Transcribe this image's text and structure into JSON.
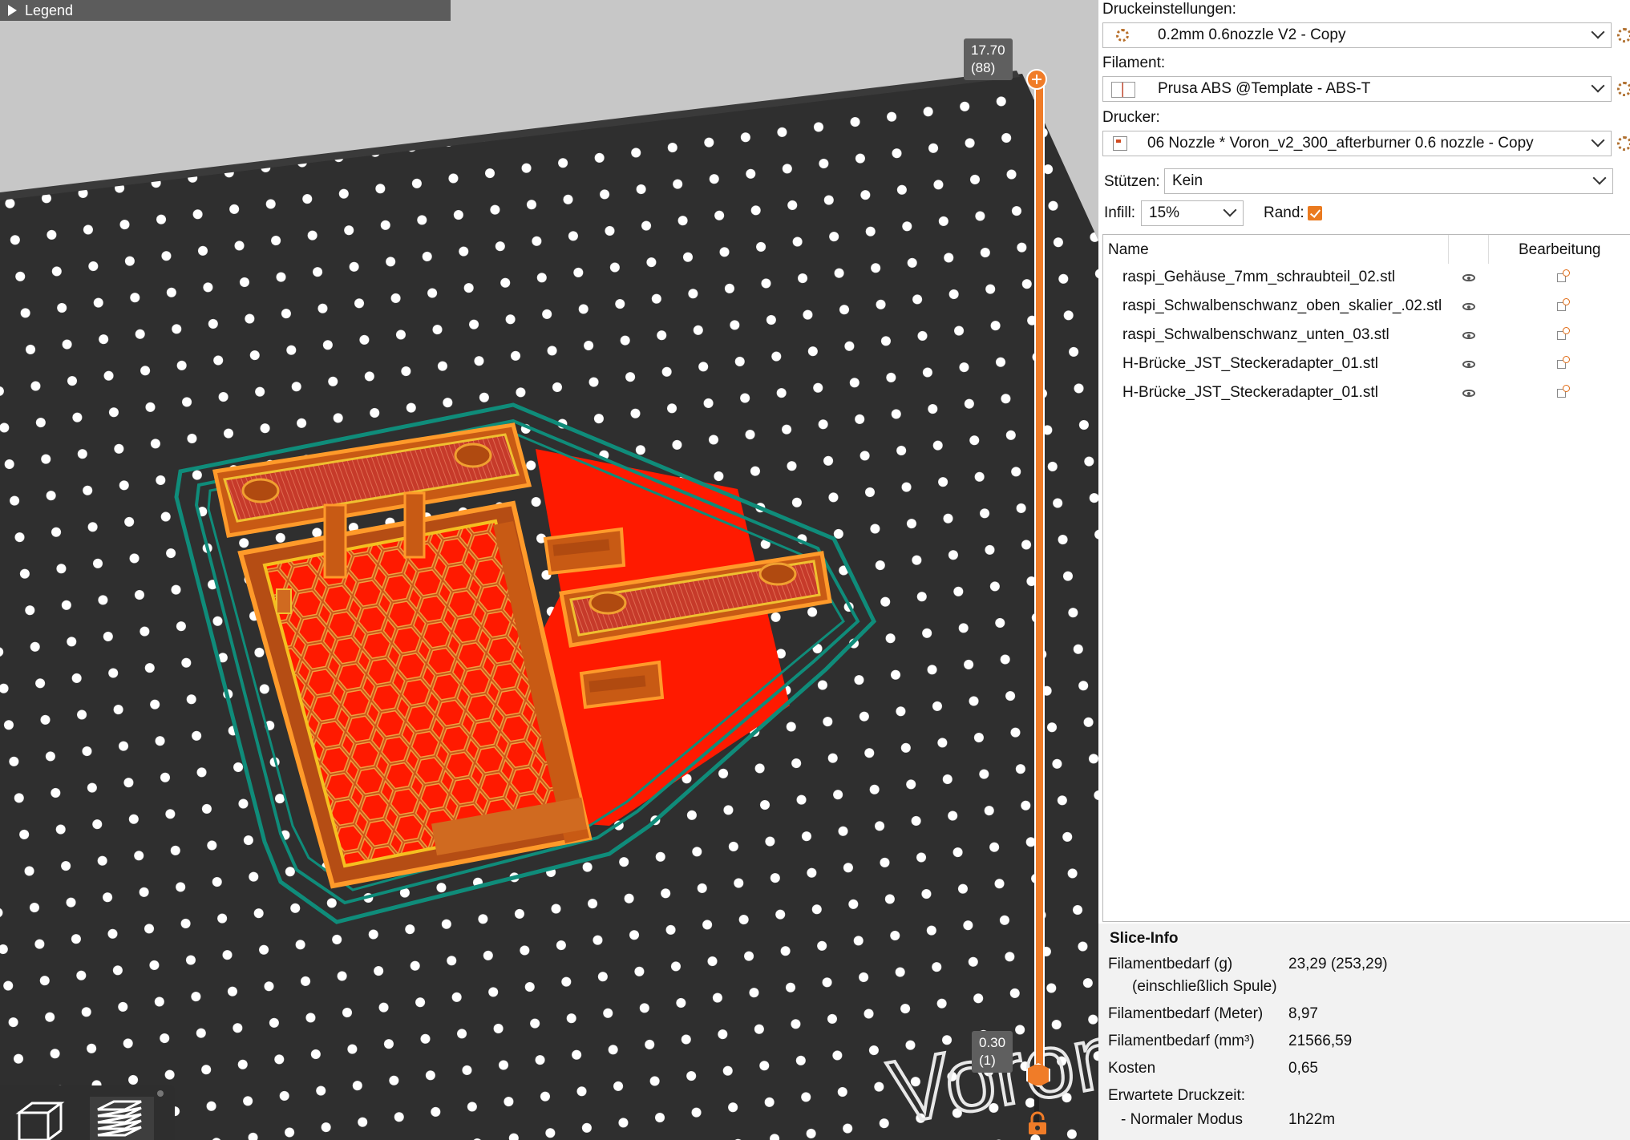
{
  "viewport": {
    "legend_label": "Legend",
    "slider_top_value": "17.70",
    "slider_top_layer": "(88)",
    "slider_bottom_value": "0.30",
    "slider_bottom_layer": "(1)",
    "bed_logo_text": "Voron",
    "view_buttons": [
      "3d-view-icon",
      "layers-view-icon"
    ],
    "colors": {
      "bed": "#2f2f2f",
      "background": "#c7c7c7",
      "perimeter": "#ff8c1a",
      "infill": "#d86a1e",
      "solid_infill": "#e10000",
      "skirt": "#0f8c7a",
      "accent": "#ea7a1f"
    }
  },
  "sidebar": {
    "print_settings_label": "Druckeinstellungen:",
    "print_settings_value": "0.2mm 0.6nozzle V2 - Copy",
    "filament_label": "Filament:",
    "filament_value": "Prusa ABS @Template - ABS-T",
    "printer_label": "Drucker:",
    "printer_value": "06 Nozzle * Voron_v2_300_afterburner 0.6 nozzle - Copy",
    "supports_label": "Stützen:",
    "supports_value": "Kein",
    "infill_label": "Infill:",
    "infill_value": "15%",
    "brim_label": "Rand:",
    "brim_checked": true
  },
  "object_list": {
    "col_name": "Name",
    "col_edit": "Bearbeitung",
    "items": [
      {
        "name": "raspi_Gehäuse_7mm_schraubteil_02.stl"
      },
      {
        "name": "raspi_Schwalbenschwanz_oben_skalier_.02.stl"
      },
      {
        "name": "raspi_Schwalbenschwanz_unten_03.stl"
      },
      {
        "name": "H-Brücke_JST_Steckeradapter_01.stl"
      },
      {
        "name": "H-Brücke_JST_Steckeradapter_01.stl"
      }
    ]
  },
  "slice_info": {
    "title": "Slice-Info",
    "filament_g_label": "Filamentbedarf (g)",
    "filament_g_sub": "(einschließlich Spule)",
    "filament_g_value": "23,29 (253,29)",
    "filament_m_label": "Filamentbedarf (Meter)",
    "filament_m_value": "8,97",
    "filament_mm3_label": "Filamentbedarf (mm³)",
    "filament_mm3_value": "21566,59",
    "cost_label": "Kosten",
    "cost_value": "0,65",
    "time_label": "Erwartete Druckzeit:",
    "mode_label": "- Normaler Modus",
    "mode_value": "1h22m"
  }
}
